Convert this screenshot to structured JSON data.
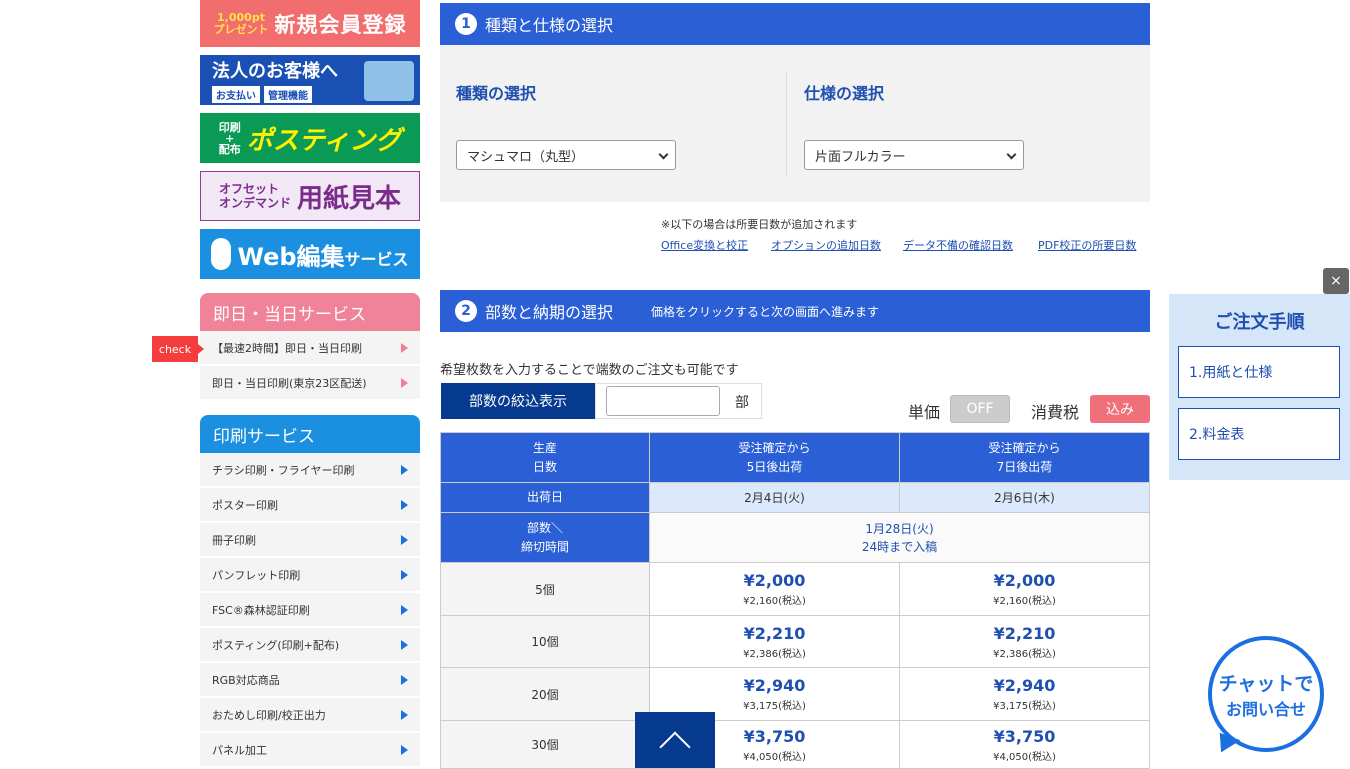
{
  "banners": {
    "signup_small": "1,000pt\nプレゼント",
    "signup_big": "新規会員登録",
    "corporate_big": "法人のお客様へ",
    "corporate_tag1": "お支払い",
    "corporate_tag2": "管理機能",
    "posting_small": "印刷\n+\n配布",
    "posting_big": "ポスティング",
    "paper_small": "オフセット\nオンデマンド",
    "paper_big": "用紙見本",
    "web_big": "Web編集",
    "web_small": "サービス"
  },
  "same_day": {
    "title": "即日・当日サービス",
    "check": "check",
    "items": [
      "【最速2時間】即日・当日印刷",
      "即日・当日印刷(東京23区配送)"
    ]
  },
  "print_service": {
    "title": "印刷サービス",
    "items": [
      "チラシ印刷・フライヤー印刷",
      "ポスター印刷",
      "冊子印刷",
      "パンフレット印刷",
      "FSC®森林認証印刷",
      "ポスティング(印刷+配布)",
      "RGB対応商品",
      "おためし印刷/校正出力",
      "パネル加工"
    ]
  },
  "section1": {
    "num": "1",
    "title": "種類と仕様の選択",
    "type_title": "種類の選択",
    "type_value": "マシュマロ（丸型）",
    "spec_title": "仕様の選択",
    "spec_value": "片面フルカラー",
    "note": "※以下の場合は所要日数が追加されます",
    "links": [
      "Office変換と校正",
      "オプションの追加日数",
      "データ不備の確認日数",
      "PDF校正の所要日数"
    ]
  },
  "section2": {
    "num": "2",
    "title": "部数と納期の選択",
    "note": "価格をクリックすると次の画面へ進みます",
    "qty_hint": "希望枚数を入力することで端数のご注文も可能です",
    "filter_button": "部数の絞込表示",
    "unit": "部",
    "unit_price_label": "単価",
    "unit_price_toggle": "OFF",
    "tax_label": "消費税",
    "tax_toggle": "込み"
  },
  "table": {
    "head_days": "生産\n日数",
    "col1": "受注確定から\n5日後出荷",
    "col2": "受注確定から\n7日後出荷",
    "ship_label": "出荷日",
    "ship1": "2月4日(火)",
    "ship2": "2月6日(木)",
    "cutoff_label": "部数＼\n締切時間",
    "cutoff": "1月28日(火)\n24時まで入稿",
    "rows": [
      {
        "qty": "5個",
        "p1": "¥2,000",
        "t1": "¥2,160(税込)",
        "p2": "¥2,000",
        "t2": "¥2,160(税込)"
      },
      {
        "qty": "10個",
        "p1": "¥2,210",
        "t1": "¥2,386(税込)",
        "p2": "¥2,210",
        "t2": "¥2,386(税込)"
      },
      {
        "qty": "20個",
        "p1": "¥2,940",
        "t1": "¥3,175(税込)",
        "p2": "¥2,940",
        "t2": "¥3,175(税込)"
      },
      {
        "qty": "30個",
        "p1": "¥3,750",
        "t1": "¥4,050(税込)",
        "p2": "¥3,750",
        "t2": "¥4,050(税込)"
      }
    ]
  },
  "order_panel": {
    "close": "×",
    "title": "ご注文手順",
    "steps": [
      "1.用紙と仕様",
      "2.料金表"
    ]
  },
  "chat": {
    "line1": "チャットで",
    "line2": "お問い合せ"
  }
}
